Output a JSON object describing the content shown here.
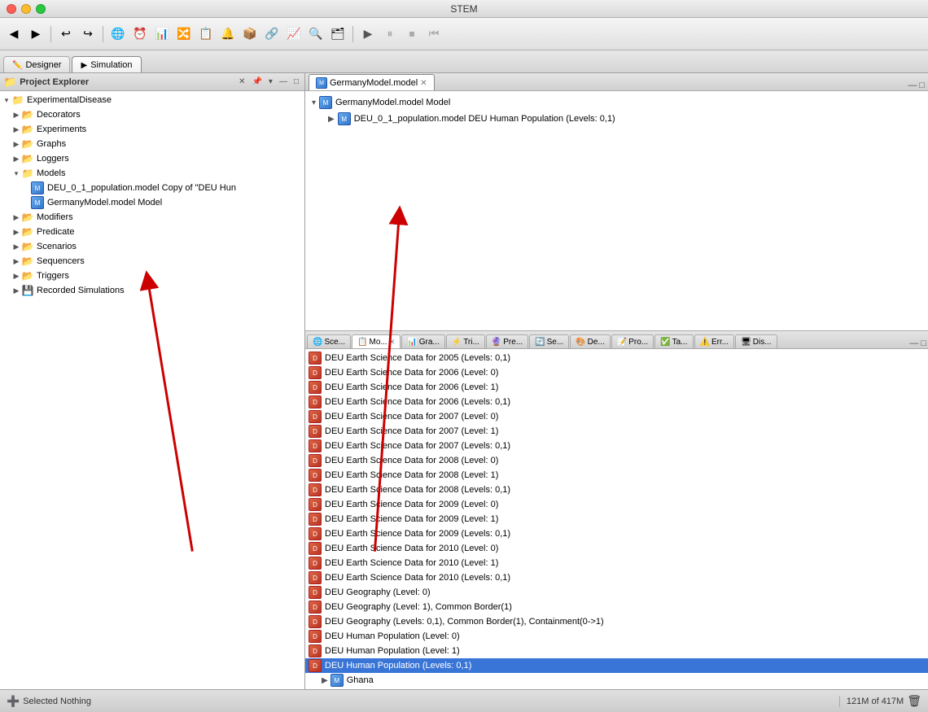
{
  "app": {
    "title": "STEM"
  },
  "titlebar": {
    "buttons": [
      "close",
      "minimize",
      "maximize"
    ]
  },
  "toolbar": {
    "groups": [
      [
        "◀",
        "▶",
        "⏸",
        "⏹",
        "⏮"
      ],
      [
        "↩",
        "↪"
      ],
      [
        "🌐",
        "⏰",
        "📊",
        "🔀",
        "📋",
        "🔔",
        "📦",
        "🔗",
        "📈",
        "🔍",
        "🗂"
      ],
      [
        "▶",
        "⏸",
        "⏹",
        "⏮"
      ]
    ]
  },
  "main_tabs": [
    {
      "label": "Designer",
      "icon": "✏️",
      "active": false
    },
    {
      "label": "Simulation",
      "icon": "▶",
      "active": true
    }
  ],
  "project_explorer": {
    "title": "Project Explorer",
    "tree": [
      {
        "id": "experimental-disease",
        "label": "ExperimentalDisease",
        "level": 0,
        "expanded": true,
        "type": "project"
      },
      {
        "id": "decorators",
        "label": "Decorators",
        "level": 1,
        "expanded": false,
        "type": "folder"
      },
      {
        "id": "experiments",
        "label": "Experiments",
        "level": 1,
        "expanded": false,
        "type": "folder"
      },
      {
        "id": "graphs",
        "label": "Graphs",
        "level": 1,
        "expanded": false,
        "type": "folder"
      },
      {
        "id": "loggers",
        "label": "Loggers",
        "level": 1,
        "expanded": false,
        "type": "folder"
      },
      {
        "id": "models",
        "label": "Models",
        "level": 1,
        "expanded": true,
        "type": "folder"
      },
      {
        "id": "deu-model",
        "label": "DEU_0_1_population.model Copy of \"DEU Hun",
        "level": 2,
        "expanded": false,
        "type": "model"
      },
      {
        "id": "germany-model",
        "label": "GermanyModel.model Model",
        "level": 2,
        "expanded": false,
        "type": "model"
      },
      {
        "id": "modifiers",
        "label": "Modifiers",
        "level": 1,
        "expanded": false,
        "type": "folder"
      },
      {
        "id": "predicate",
        "label": "Predicate",
        "level": 1,
        "expanded": false,
        "type": "folder"
      },
      {
        "id": "scenarios",
        "label": "Scenarios",
        "level": 1,
        "expanded": false,
        "type": "folder"
      },
      {
        "id": "sequencers",
        "label": "Sequencers",
        "level": 1,
        "expanded": false,
        "type": "folder"
      },
      {
        "id": "triggers",
        "label": "Triggers",
        "level": 1,
        "expanded": false,
        "type": "folder"
      },
      {
        "id": "recorded-simulations",
        "label": "Recorded Simulations",
        "level": 1,
        "expanded": false,
        "type": "folder"
      }
    ]
  },
  "editor": {
    "tabs": [
      {
        "id": "germany-model-tab",
        "label": "GermanyModel.model",
        "active": true,
        "closeable": true
      }
    ],
    "content": {
      "root_label": "GermanyModel.model Model",
      "child_label": "DEU_0_1_population.model DEU Human Population (Levels: 0,1)"
    }
  },
  "bottom_panel": {
    "tabs": [
      {
        "id": "scenarios-tab",
        "label": "Sce...",
        "active": false,
        "icon": "🌐"
      },
      {
        "id": "models-tab",
        "label": "Mo...",
        "active": true,
        "icon": "📋",
        "closeable": true
      },
      {
        "id": "graphs-tab",
        "label": "Gra...",
        "active": false,
        "icon": "📊"
      },
      {
        "id": "triggers-tab",
        "label": "Tri...",
        "active": false,
        "icon": "⚡"
      },
      {
        "id": "predicate-tab",
        "label": "Pre...",
        "active": false,
        "icon": "🔮"
      },
      {
        "id": "sequencers-tab",
        "label": "Se...",
        "active": false,
        "icon": "🔄"
      },
      {
        "id": "decorators-tab",
        "label": "De...",
        "active": false,
        "icon": "🎨"
      },
      {
        "id": "properties-tab",
        "label": "Pro...",
        "active": false,
        "icon": "📝"
      },
      {
        "id": "tasks-tab",
        "label": "Ta...",
        "active": false,
        "icon": "✅"
      },
      {
        "id": "errors-tab",
        "label": "Err...",
        "active": false,
        "icon": "⚠️"
      },
      {
        "id": "display-tab",
        "label": "Dis...",
        "active": false,
        "icon": "🖥"
      }
    ],
    "data_items": [
      "DEU Earth Science Data for 2005 (Levels: 0,1)",
      "DEU Earth Science Data for 2006 (Level: 0)",
      "DEU Earth Science Data for 2006 (Level: 1)",
      "DEU Earth Science Data for 2006 (Levels: 0,1)",
      "DEU Earth Science Data for 2007 (Level: 0)",
      "DEU Earth Science Data for 2007 (Level: 1)",
      "DEU Earth Science Data for 2007 (Levels: 0,1)",
      "DEU Earth Science Data for 2008 (Level: 0)",
      "DEU Earth Science Data for 2008 (Level: 1)",
      "DEU Earth Science Data for 2008 (Levels: 0,1)",
      "DEU Earth Science Data for 2009 (Level: 0)",
      "DEU Earth Science Data for 2009 (Level: 1)",
      "DEU Earth Science Data for 2009 (Levels: 0,1)",
      "DEU Earth Science Data for 2010 (Level: 0)",
      "DEU Earth Science Data for 2010 (Level: 1)",
      "DEU Earth Science Data for 2010 (Levels: 0,1)",
      "DEU Geography (Level: 0)",
      "DEU Geography (Level: 1), Common Border(1)",
      "DEU Geography (Levels: 0,1), Common Border(1), Containment(0->1)",
      "DEU Human Population (Level: 0)",
      "DEU Human Population (Level: 1)",
      "DEU Human Population (Levels: 0,1)"
    ],
    "selected_item": "DEU Human Population (Levels: 0,1)",
    "sub_item": "Ghana"
  },
  "status_bar": {
    "left_icon": "➕",
    "status_text": "Selected Nothing",
    "memory_text": "121M of 417M",
    "trash_icon": "🗑"
  }
}
